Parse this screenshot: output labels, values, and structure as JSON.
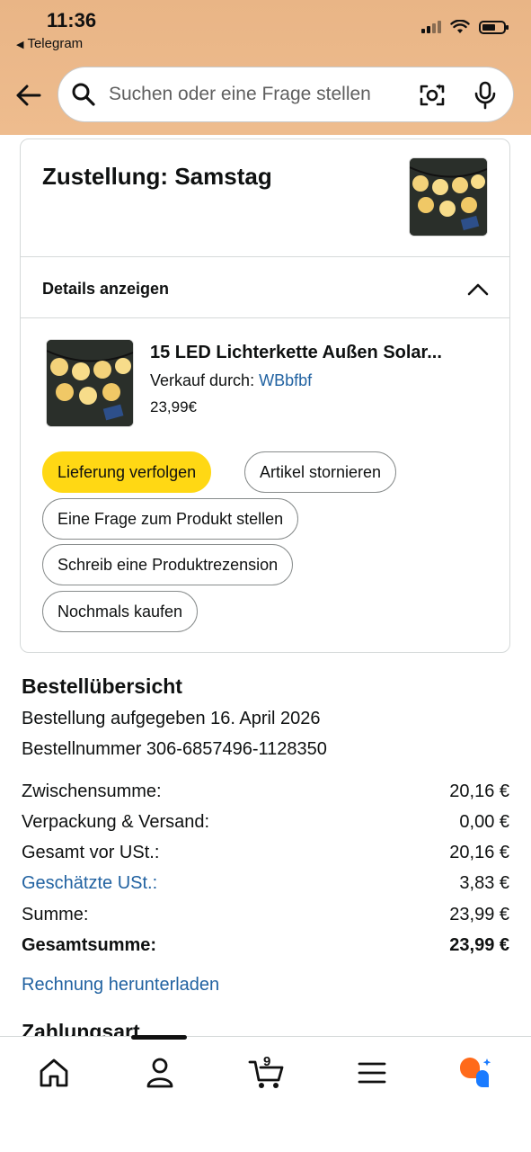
{
  "status_bar": {
    "time": "11:36",
    "back_app": "Telegram"
  },
  "search": {
    "placeholder": "Suchen oder eine Frage stellen"
  },
  "card": {
    "delivery_title": "Zustellung: Samstag",
    "details_label": "Details anzeigen",
    "product": {
      "title": "15 LED Lichterkette Außen Solar...",
      "seller_prefix": "Verkauf durch:",
      "seller_name": "WBbfbf",
      "price": "23,99€"
    },
    "actions": {
      "track": "Lieferung verfolgen",
      "cancel": "Artikel stornieren",
      "question": "Eine Frage zum Produkt stellen",
      "review": "Schreib eine Produktrezension",
      "rebuy": "Nochmals kaufen"
    }
  },
  "summary": {
    "title": "Bestellübersicht",
    "order_date": "Bestellung aufgegeben 16. April 2026",
    "order_number": "Bestellnummer 306-6857496-1128350",
    "rows": [
      {
        "label": "Zwischensumme:",
        "value": "20,16 €"
      },
      {
        "label": "Verpackung & Versand:",
        "value": "0,00 €"
      },
      {
        "label": "Gesamt vor USt.:",
        "value": "20,16 €"
      },
      {
        "label": "Geschätzte USt.:",
        "value": "3,83 €"
      },
      {
        "label": "Summe:",
        "value": "23,99 €"
      },
      {
        "label": "Gesamtsumme:",
        "value": "23,99 €"
      }
    ],
    "download_invoice": "Rechnung herunterladen",
    "payment_heading": "Zahlungsart"
  },
  "tabbar": {
    "cart_count": "9",
    "icons": [
      "home-icon",
      "account-icon",
      "cart-icon",
      "menu-icon",
      "assistant-icon"
    ]
  },
  "colors": {
    "header_bg": "#eebc8e",
    "primary_button": "#ffd814",
    "link": "#2162a1",
    "assistant_orange": "#ff6a1a",
    "assistant_blue": "#1a7bff"
  }
}
